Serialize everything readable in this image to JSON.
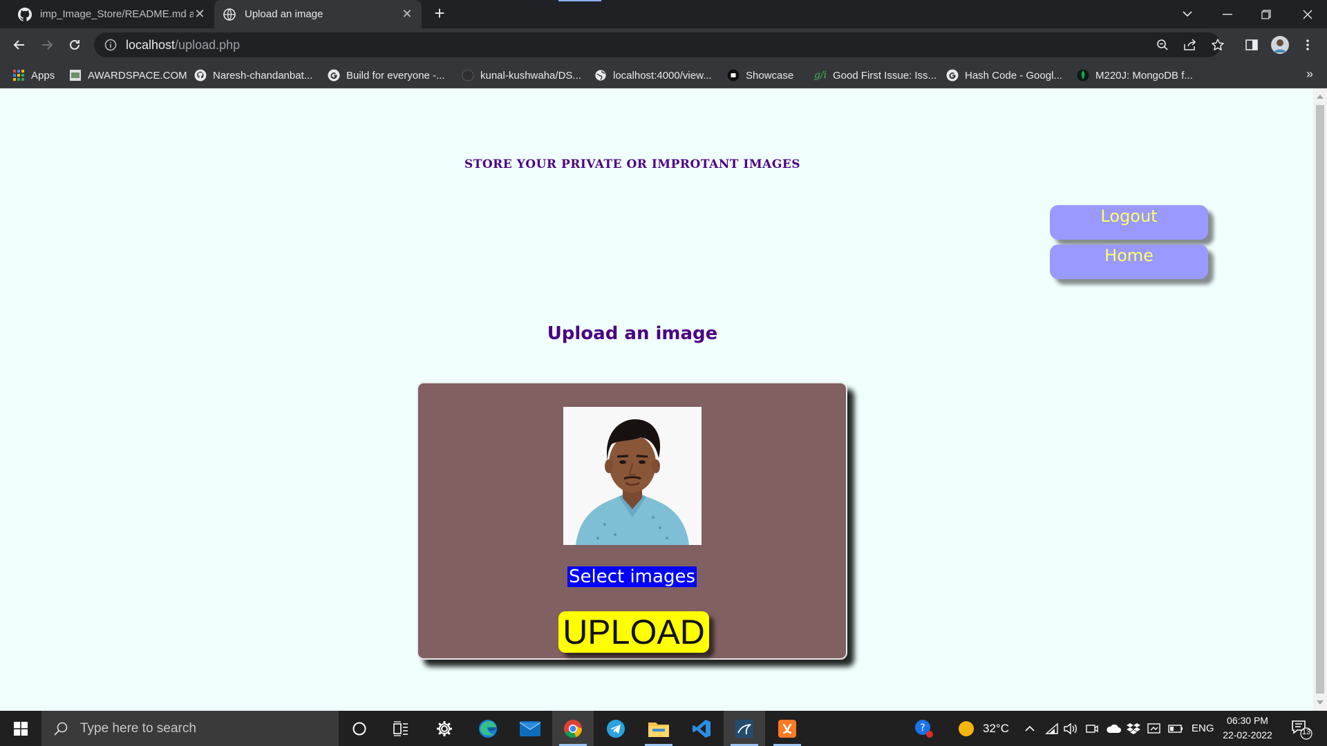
{
  "browser": {
    "tabs": [
      {
        "title": "imp_Image_Store/README.md at",
        "active": false
      },
      {
        "title": "Upload an image",
        "active": true
      }
    ],
    "url_host": "localhost",
    "url_path": "/upload.php",
    "bookmarks": [
      {
        "label": "Apps",
        "icon": "apps-grid-icon"
      },
      {
        "label": "AWARDSPACE.COM",
        "icon": "awardspace-icon"
      },
      {
        "label": "Naresh-chandanbat...",
        "icon": "github-icon"
      },
      {
        "label": "Build for everyone -...",
        "icon": "google-icon"
      },
      {
        "label": "kunal-kushwaha/DS...",
        "icon": "github-icon"
      },
      {
        "label": "localhost:4000/view...",
        "icon": "globe-icon"
      },
      {
        "label": "Showcase",
        "icon": "showcase-icon"
      },
      {
        "label": "Good First Issue: Iss...",
        "icon": "gfi-icon"
      },
      {
        "label": "Hash Code - Googl...",
        "icon": "google-icon"
      },
      {
        "label": "M220J: MongoDB f...",
        "icon": "mongodb-leaf-icon"
      }
    ]
  },
  "page": {
    "header": "STORE YOUR PRIVATE OR IMPROTANT IMAGES",
    "logout_label": "Logout",
    "home_label": "Home",
    "upload_title": "Upload an image",
    "select_label": "Select images",
    "upload_label": "UPLOAD"
  },
  "taskbar": {
    "search_placeholder": "Type here to search",
    "temperature": "32°C",
    "language": "ENG",
    "time": "06:30 PM",
    "date": "22-02-2022",
    "notification_count": "13"
  },
  "colors": {
    "page_bg": "#f0fffe",
    "heading": "#4b0082",
    "side_button_bg": "#9999ff",
    "side_button_text": "#ffff66",
    "card_bg": "#806060",
    "select_bg": "#0000ff",
    "upload_button_bg": "#ffff00"
  }
}
